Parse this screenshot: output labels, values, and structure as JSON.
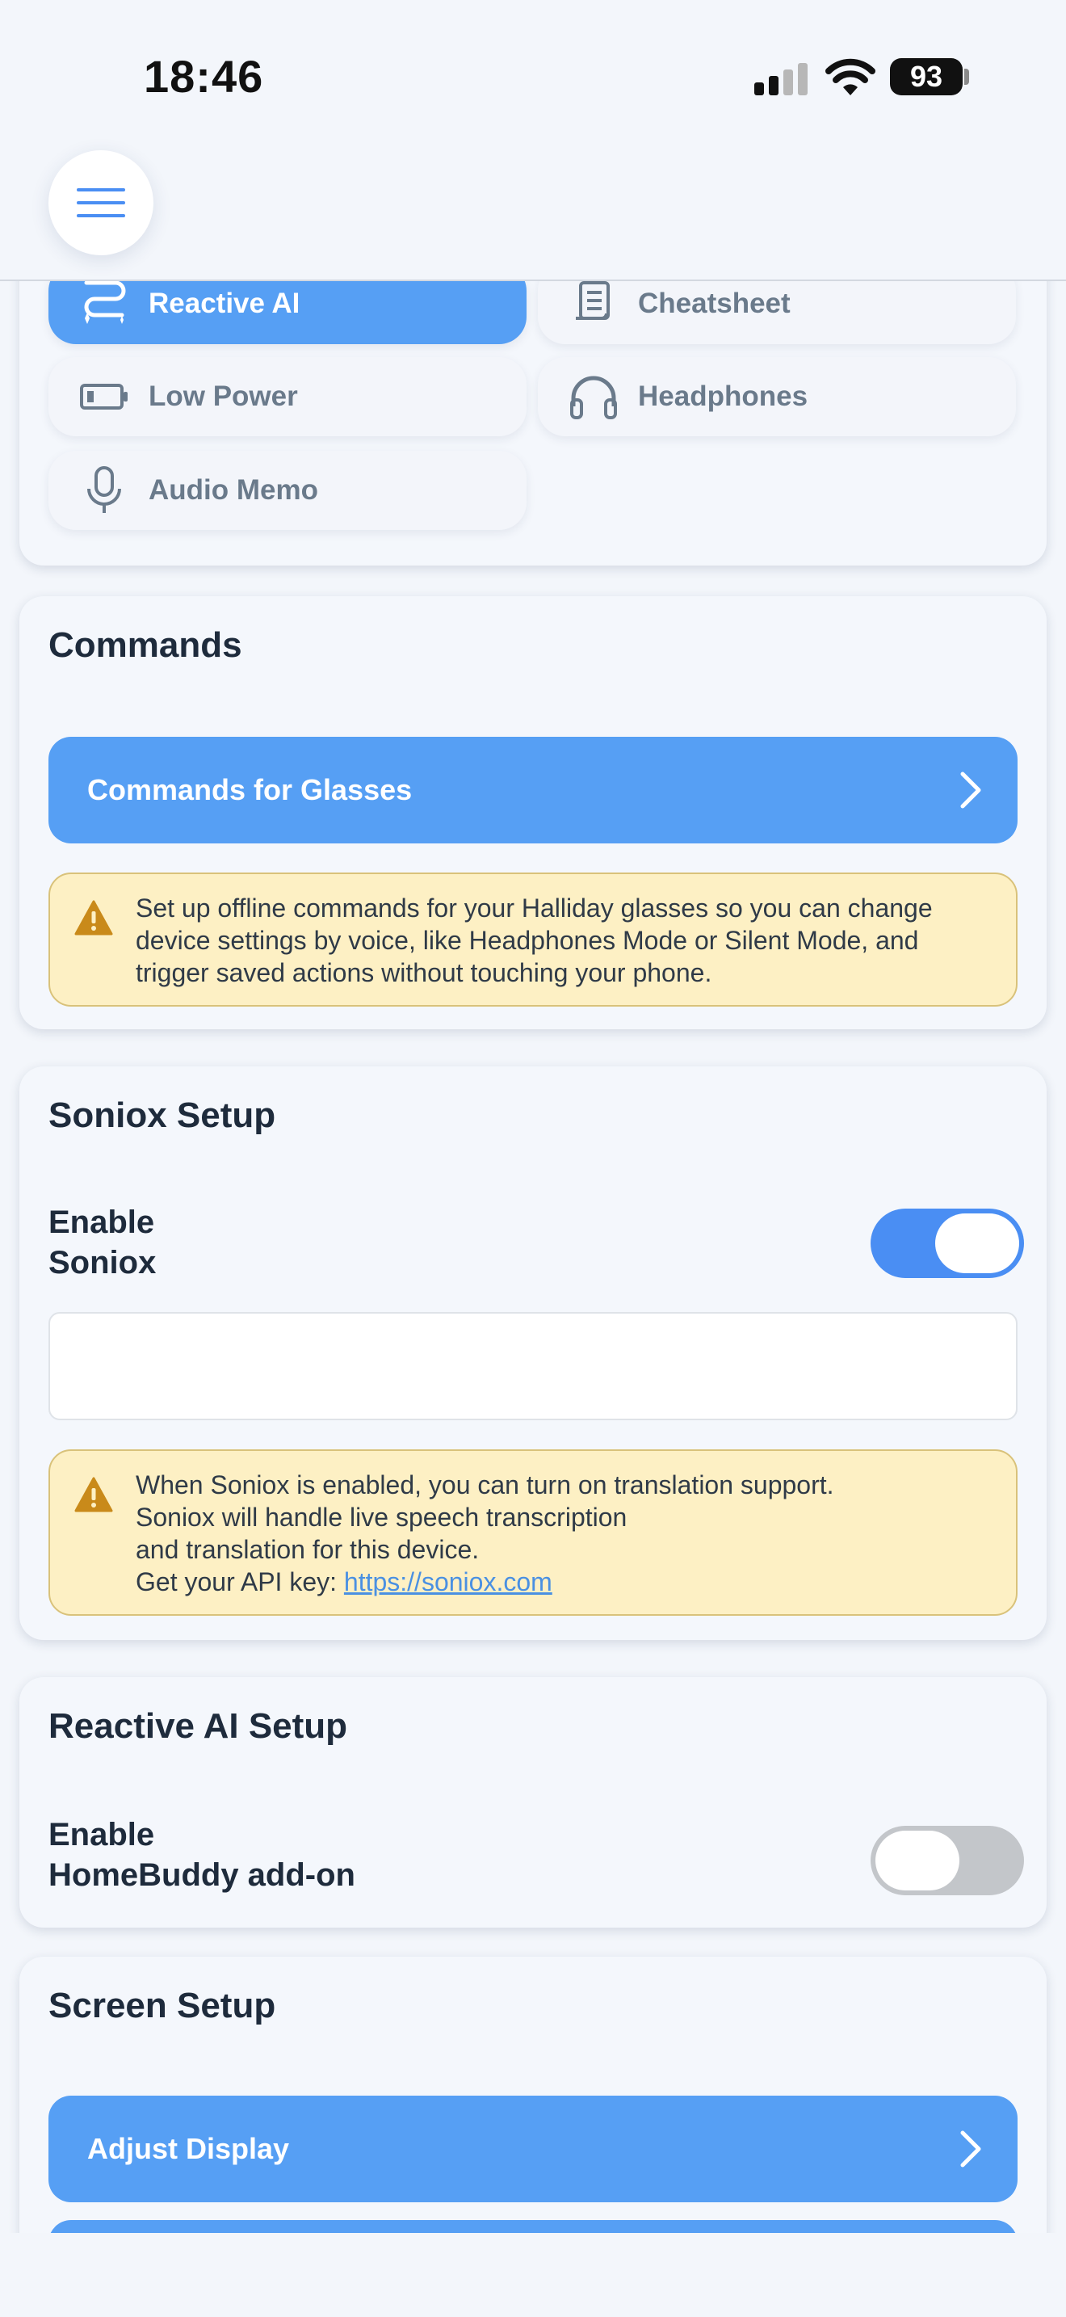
{
  "status": {
    "time": "18:46",
    "battery": "93"
  },
  "modes": [
    {
      "label": "Reactive AI",
      "icon": "reactive-ai-icon",
      "active": true
    },
    {
      "label": "Cheatsheet",
      "icon": "scroll-icon",
      "active": false
    },
    {
      "label": "Low Power",
      "icon": "battery-low-icon",
      "active": false
    },
    {
      "label": "Headphones",
      "icon": "headphones-icon",
      "active": false
    },
    {
      "label": "Audio Memo",
      "icon": "microphone-icon",
      "active": false
    }
  ],
  "commands": {
    "title": "Commands",
    "button_label": "Commands for Glasses",
    "warning": "Set up offline commands for your Halliday glasses so you can change device settings by voice, like Headphones Mode or Silent Mode, and trigger saved actions without touching your phone."
  },
  "soniox": {
    "title": "Soniox Setup",
    "toggle_label_line1": "Enable",
    "toggle_label_line2": "Soniox",
    "toggle_on": true,
    "api_key_value": "",
    "warning_line1": "When Soniox is enabled, you can turn on translation support.",
    "warning_line2": "Soniox will handle live speech transcription",
    "warning_line3": "and translation for this device.",
    "warning_line4": "Get your API key: ",
    "link": "https://soniox.com"
  },
  "reactive_ai": {
    "title": "Reactive AI Setup",
    "toggle_label_line1": "Enable",
    "toggle_label_line2": "HomeBuddy add-on",
    "toggle_on": false
  },
  "screen": {
    "title": "Screen Setup",
    "button_label": "Adjust Display"
  },
  "colors": {
    "accent": "#569ff4",
    "warning_bg": "#fdf0c4",
    "warning_icon": "#c98a1a"
  }
}
